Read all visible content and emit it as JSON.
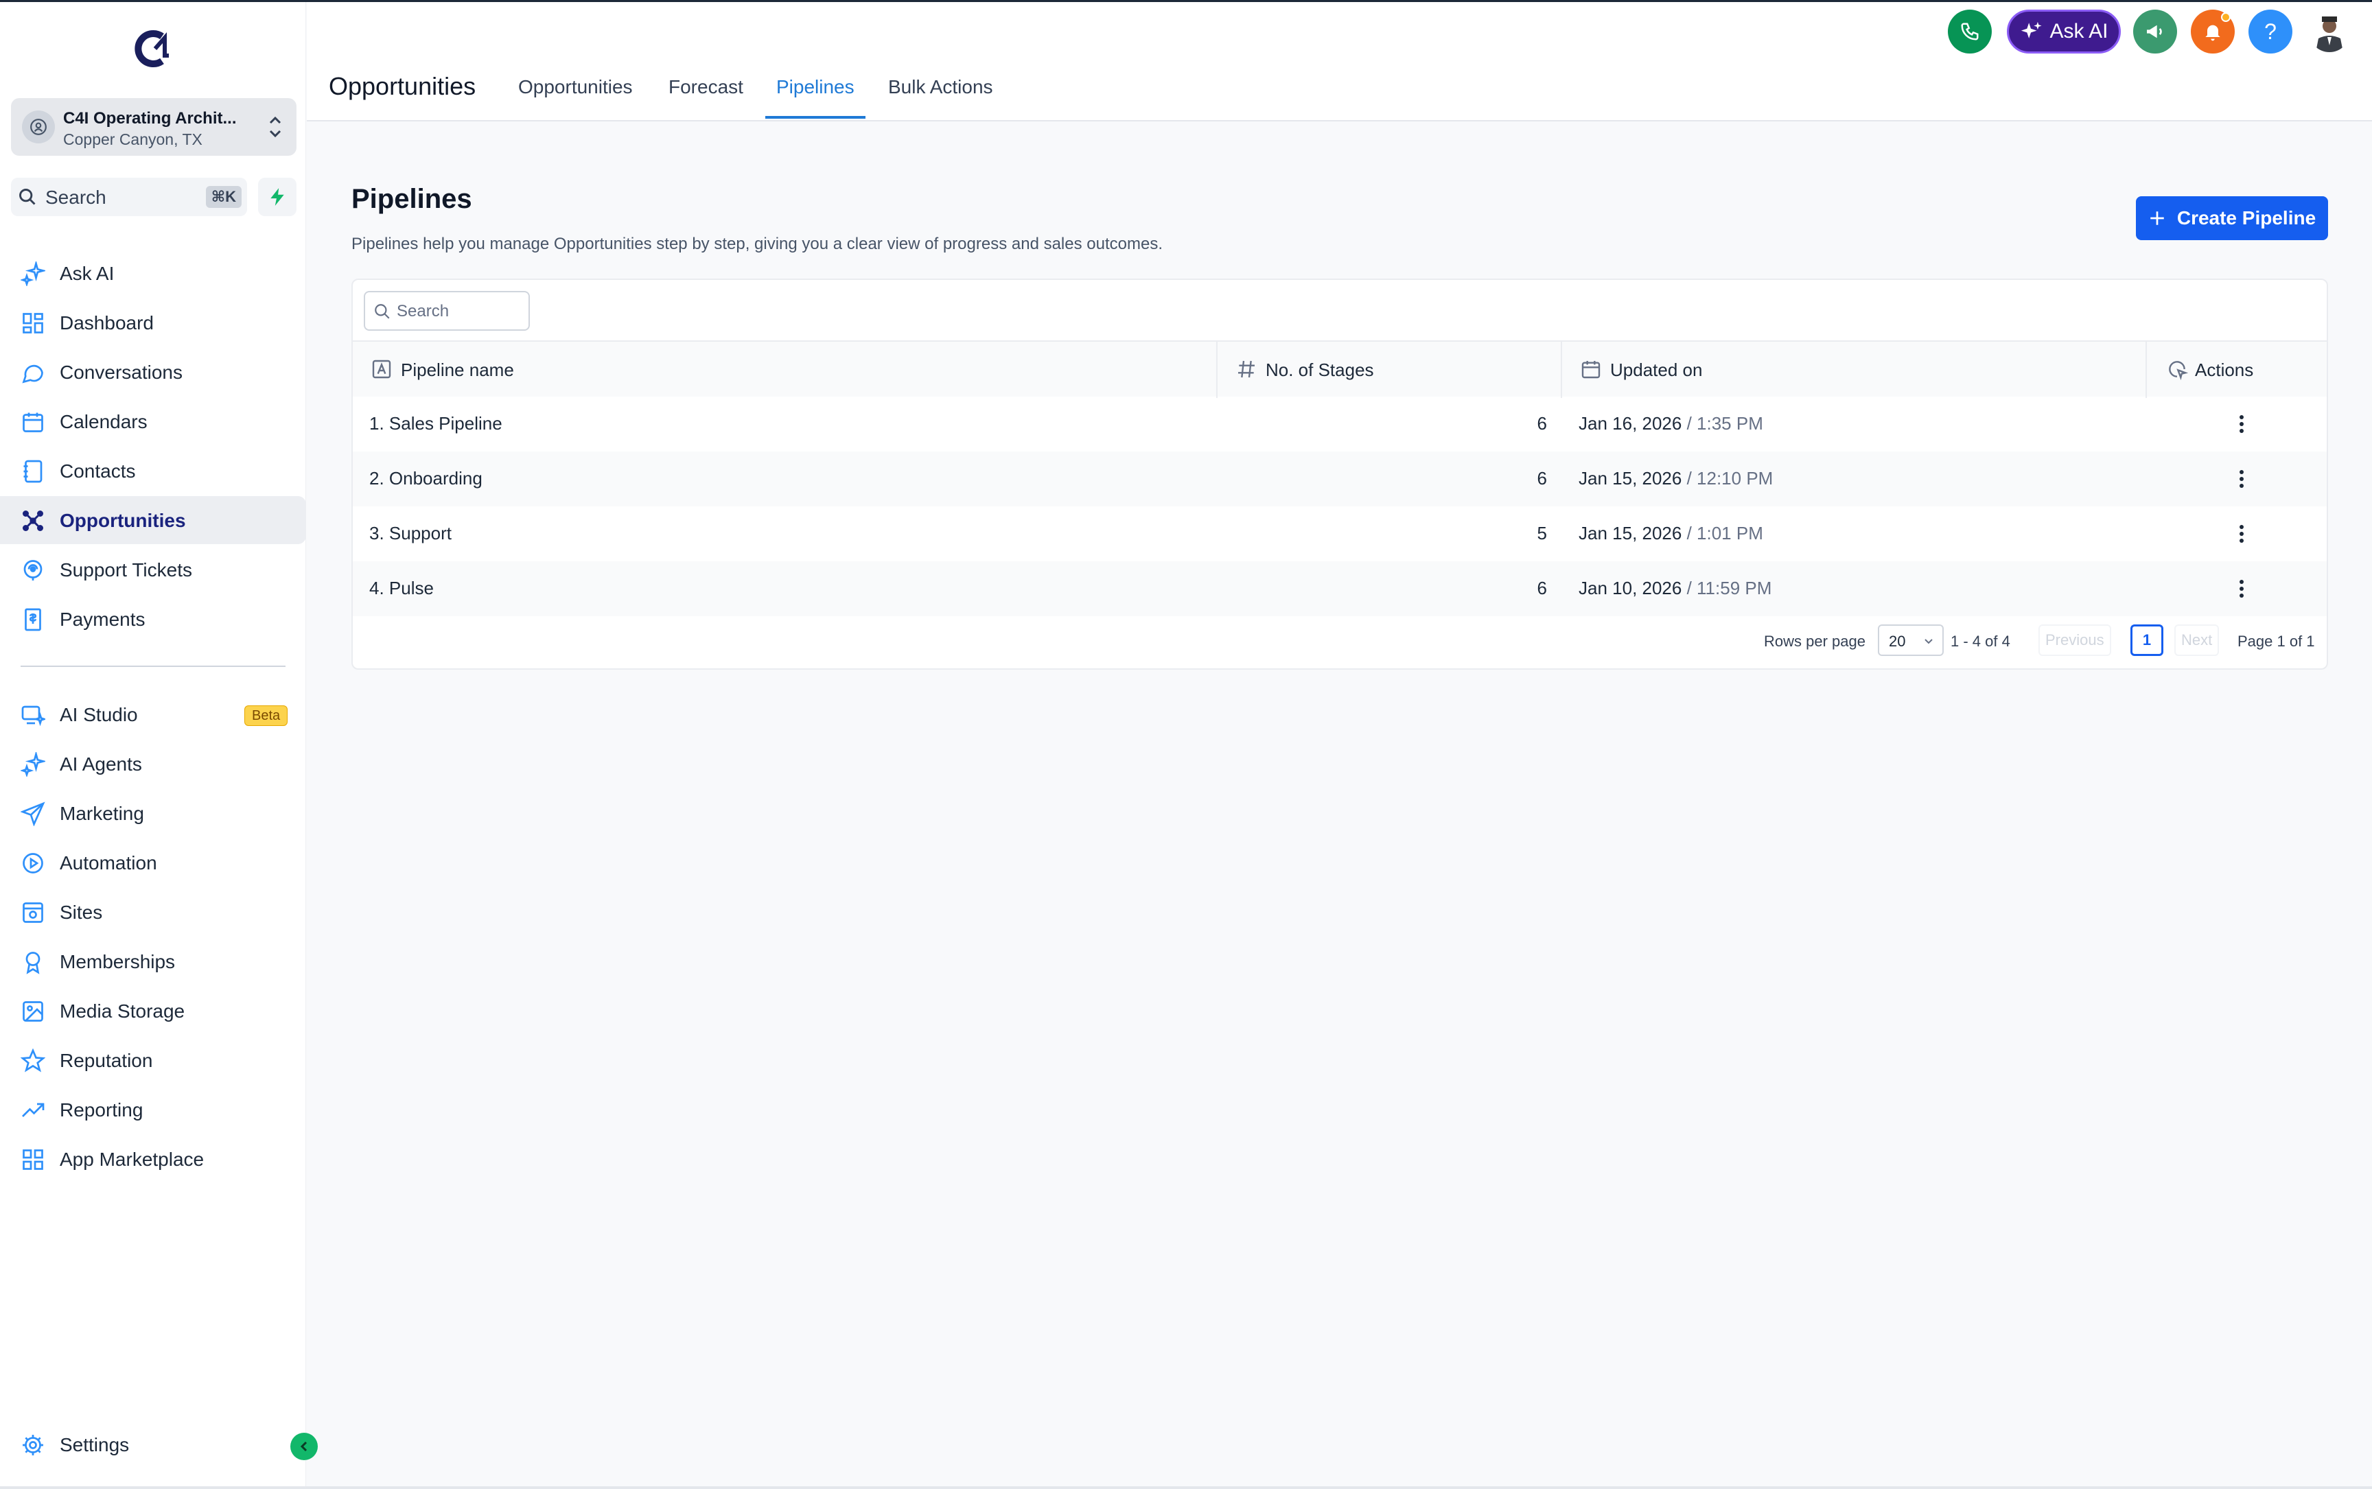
{
  "sidebar": {
    "location": {
      "name": "C4I Operating Archit...",
      "sub": "Copper Canyon, TX"
    },
    "search": {
      "label": "Search",
      "shortcut": "⌘K"
    },
    "items": [
      {
        "label": "Ask AI",
        "icon": "sparkle-icon"
      },
      {
        "label": "Dashboard",
        "icon": "dashboard-grid-icon"
      },
      {
        "label": "Conversations",
        "icon": "chat-bubble-icon"
      },
      {
        "label": "Calendars",
        "icon": "calendar-icon"
      },
      {
        "label": "Contacts",
        "icon": "contacts-book-icon"
      },
      {
        "label": "Opportunities",
        "icon": "opportunities-icon",
        "active": true
      },
      {
        "label": "Support Tickets",
        "icon": "support-icon"
      },
      {
        "label": "Payments",
        "icon": "receipt-icon"
      }
    ],
    "items2": [
      {
        "label": "AI Studio",
        "icon": "ai-studio-icon",
        "badge": "Beta"
      },
      {
        "label": "AI Agents",
        "icon": "sparkle-icon"
      },
      {
        "label": "Marketing",
        "icon": "send-icon"
      },
      {
        "label": "Automation",
        "icon": "play-circle-icon"
      },
      {
        "label": "Sites",
        "icon": "browser-icon"
      },
      {
        "label": "Memberships",
        "icon": "award-icon"
      },
      {
        "label": "Media Storage",
        "icon": "image-icon"
      },
      {
        "label": "Reputation",
        "icon": "star-icon"
      },
      {
        "label": "Reporting",
        "icon": "trend-up-icon"
      },
      {
        "label": "App Marketplace",
        "icon": "apps-grid-icon"
      }
    ],
    "settings": {
      "label": "Settings",
      "icon": "gear-icon"
    }
  },
  "header": {
    "title": "Opportunities",
    "tabs": [
      {
        "label": "Opportunities"
      },
      {
        "label": "Forecast"
      },
      {
        "label": "Pipelines",
        "active": true
      },
      {
        "label": "Bulk Actions"
      }
    ],
    "ask_ai_label": "Ask AI",
    "help_label": "?",
    "colors": {
      "phone": "#079455",
      "ask_ai": "#3f1b8f",
      "announce": "#3b9a6f",
      "bell": "#f26b1d",
      "help": "#2e90fa"
    }
  },
  "main": {
    "title": "Pipelines",
    "description": "Pipelines help you manage Opportunities step by step, giving you a clear view of progress and sales outcomes.",
    "create_label": "Create Pipeline",
    "search_placeholder": "Search",
    "columns": [
      {
        "label": "Pipeline name",
        "icon": "text-field-icon"
      },
      {
        "label": "No. of Stages",
        "icon": "hash-icon"
      },
      {
        "label": "Updated on",
        "icon": "calendar-icon"
      },
      {
        "label": "Actions",
        "icon": "cursor-click-icon"
      }
    ],
    "rows": [
      {
        "name": "1. Sales Pipeline",
        "stages": "6",
        "date": "Jan 16, 2026",
        "time": "1:35 PM"
      },
      {
        "name": "2. Onboarding",
        "stages": "6",
        "date": "Jan 15, 2026",
        "time": "12:10 PM"
      },
      {
        "name": "3. Support",
        "stages": "5",
        "date": "Jan 15, 2026",
        "time": "1:01 PM"
      },
      {
        "name": "4. Pulse",
        "stages": "6",
        "date": "Jan 10, 2026",
        "time": "11:59 PM"
      }
    ],
    "pager": {
      "rows_per_page_label": "Rows per page",
      "rows_per_page": "20",
      "range": "1 - 4 of 4",
      "previous": "Previous",
      "page": "1",
      "next": "Next",
      "page_of": "Page 1 of 1"
    },
    "accent": "#155eef"
  }
}
